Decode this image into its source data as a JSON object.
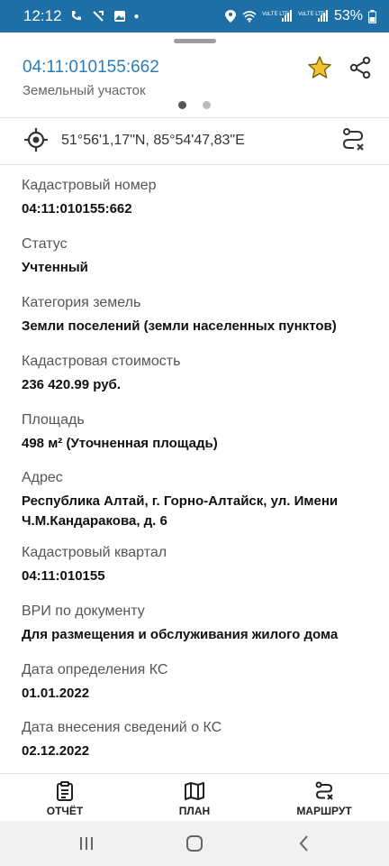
{
  "status_bar": {
    "time": "12:12",
    "network_1": "VoLTE LTE1",
    "network_2": "VoLTE LTE2",
    "battery": "53%"
  },
  "header": {
    "title": "04:11:010155:662",
    "subtitle": "Земельный участок",
    "pager": {
      "count": 2,
      "active_index": 0
    }
  },
  "coordinates": {
    "text": "51°56'1,17\"N, 85°54'47,83\"E"
  },
  "properties": [
    {
      "label": "Кадастровый номер",
      "value": "04:11:010155:662"
    },
    {
      "label": "Статус",
      "value": "Учтенный"
    },
    {
      "label": "Категория земель",
      "value": "Земли поселений (земли населенных пунктов)"
    },
    {
      "label": "Кадастровая стоимость",
      "value": "236 420.99 руб."
    },
    {
      "label": "Площадь",
      "value": "498 м² (Уточненная площадь)"
    },
    {
      "label": "Адрес",
      "value": "Республика Алтай, г. Горно-Алтайск, ул. Имени Ч.М.Кандаракова, д. 6"
    },
    {
      "label": "Кадастровый квартал",
      "value": "04:11:010155"
    },
    {
      "label": "ВРИ по документу",
      "value": "Для размещения и обслуживания жилого дома"
    },
    {
      "label": "Дата определения КС",
      "value": "01.01.2022"
    },
    {
      "label": "Дата внесения сведений о КС",
      "value": "02.12.2022"
    }
  ],
  "bottom_nav": {
    "report": "ОТЧЁТ",
    "plan": "ПЛАН",
    "route": "МАРШРУТ"
  },
  "colors": {
    "status_bar": "#1e6fa6",
    "title": "#2a7db8",
    "star": "#f2c230"
  }
}
